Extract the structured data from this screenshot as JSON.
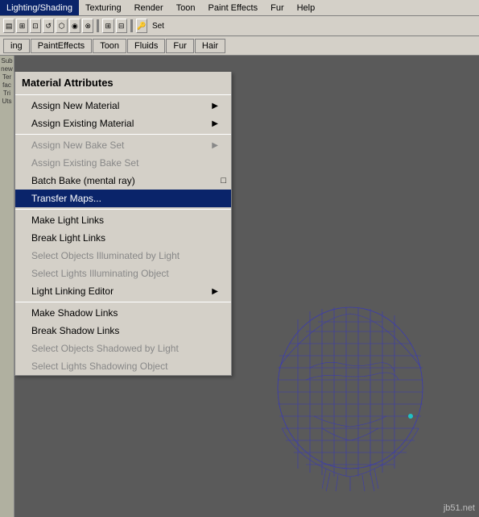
{
  "menubar": {
    "items": [
      {
        "label": "Lighting/Shading",
        "active": true
      },
      {
        "label": "Texturing"
      },
      {
        "label": "Render"
      },
      {
        "label": "Toon"
      },
      {
        "label": "Paint Effects"
      },
      {
        "label": "Fur"
      },
      {
        "label": "Help"
      }
    ]
  },
  "toolbar": {
    "tabs": [
      {
        "label": "ing"
      },
      {
        "label": "PaintEffects"
      },
      {
        "label": "Toon"
      },
      {
        "label": "Fluids"
      },
      {
        "label": "Fur"
      },
      {
        "label": "Hair"
      }
    ]
  },
  "dropdown": {
    "items": [
      {
        "label": "Material Attributes",
        "type": "normal",
        "indent": true
      },
      {
        "label": "separator"
      },
      {
        "label": "Assign New Material",
        "type": "arrow"
      },
      {
        "label": "Assign Existing Material",
        "type": "arrow"
      },
      {
        "label": "separator"
      },
      {
        "label": "Assign New Bake Set",
        "type": "arrow",
        "disabled": true
      },
      {
        "label": "Assign Existing Bake Set",
        "type": "normal",
        "disabled": true
      },
      {
        "label": "Batch Bake (mental ray)",
        "type": "batch"
      },
      {
        "label": "Transfer Maps...",
        "type": "highlighted"
      },
      {
        "label": "separator"
      },
      {
        "label": "Make Light Links",
        "type": "normal"
      },
      {
        "label": "Break Light Links",
        "type": "normal"
      },
      {
        "label": "Select Objects Illuminated by Light",
        "type": "disabled"
      },
      {
        "label": "Select Lights Illuminating Object",
        "type": "disabled"
      },
      {
        "label": "Light Linking Editor",
        "type": "arrow"
      },
      {
        "label": "separator"
      },
      {
        "label": "Make Shadow Links",
        "type": "normal"
      },
      {
        "label": "Break Shadow Links",
        "type": "normal"
      },
      {
        "label": "Select Objects Shadowed by Light",
        "type": "disabled"
      },
      {
        "label": "Select Lights Shadowing Object",
        "type": "disabled"
      }
    ]
  },
  "sidebar_labels": [
    "Sub",
    "new",
    "Ter",
    "fac",
    "Tri",
    "Uts"
  ],
  "watermark": "jb51.net"
}
